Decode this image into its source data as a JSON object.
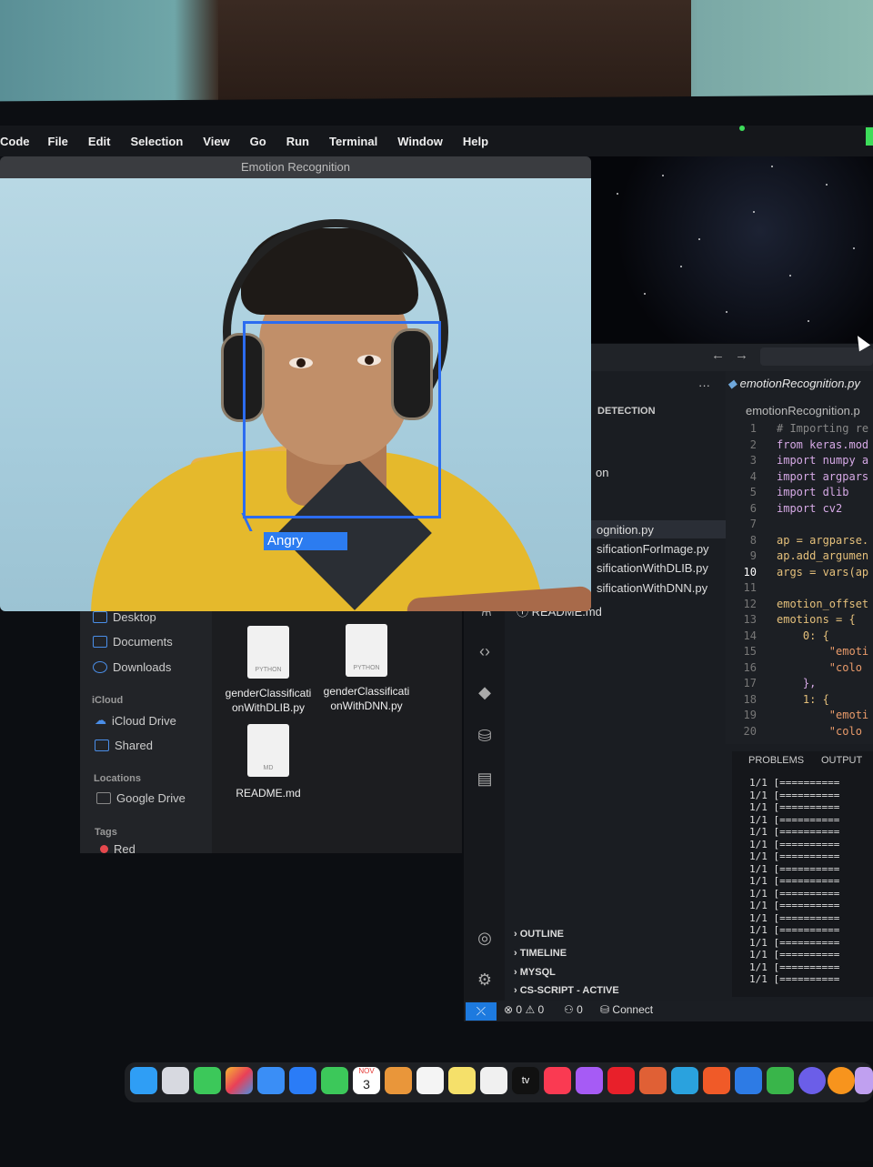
{
  "menubar": {
    "app": "Code",
    "items": [
      "File",
      "Edit",
      "Selection",
      "View",
      "Go",
      "Run",
      "Terminal",
      "Window",
      "Help"
    ]
  },
  "camera_window": {
    "title": "Emotion Recognition",
    "detection_label": "Angry"
  },
  "finder": {
    "favorites": [
      "Desktop",
      "Documents",
      "Downloads"
    ],
    "icloud_section": "iCloud",
    "icloud": [
      "iCloud Drive",
      "Shared"
    ],
    "locations_section": "Locations",
    "locations": [
      "Google Drive"
    ],
    "tags_section": "Tags",
    "tags": [
      "Red"
    ],
    "files": [
      {
        "name": "genderClassificationWithDLIB.py",
        "line1": "genderClassificati",
        "line2": "onWithDLIB.py",
        "badge": "PYTHON"
      },
      {
        "name": "genderClassificationWithDNN.py",
        "line1": "genderClassificati",
        "line2": "onWithDNN.py",
        "badge": "PYTHON"
      },
      {
        "name": "README.md",
        "line1": "README.md",
        "line2": "",
        "badge": "MD"
      }
    ]
  },
  "vscode": {
    "more_actions": "···",
    "explorer_section": "DETECTION",
    "explorer_partial": "on",
    "files": [
      "ognition.py",
      "sificationForImage.py",
      "sificationWithDLIB.py",
      "sificationWithDNN.py"
    ],
    "readme": "README.md",
    "tab": "emotionRecognition.py",
    "breadcrumb": "emotionRecognition.p",
    "line_numbers": [
      "1",
      "2",
      "3",
      "4",
      "5",
      "6",
      "7",
      "8",
      "9",
      "10",
      "11",
      "12",
      "13",
      "14",
      "15",
      "16",
      "17",
      "18",
      "19",
      "20"
    ],
    "code_lines": [
      "# Importing re",
      "from keras.mod",
      "import numpy a",
      "import argpars",
      "import dlib",
      "import cv2",
      "",
      "ap = argparse.",
      "ap.add_argumen",
      "args = vars(ap",
      "",
      "emotion_offset",
      "emotions = {",
      "    0: {",
      "        \"emoti",
      "        \"colo",
      "    },",
      "    1: {",
      "        \"emoti",
      "        \"colo"
    ],
    "panel_tabs": [
      "PROBLEMS",
      "OUTPUT"
    ],
    "output_line": "1/1 [==========",
    "sections": [
      "OUTLINE",
      "TIMELINE",
      "MYSQL",
      "CS-SCRIPT - ACTIVE"
    ],
    "status": {
      "errors": "0",
      "warnings": "0",
      "ports": "0",
      "connect": "Connect"
    }
  },
  "dock": {
    "calendar_month": "NOV",
    "calendar_day": "3",
    "tv_label": "tv"
  }
}
